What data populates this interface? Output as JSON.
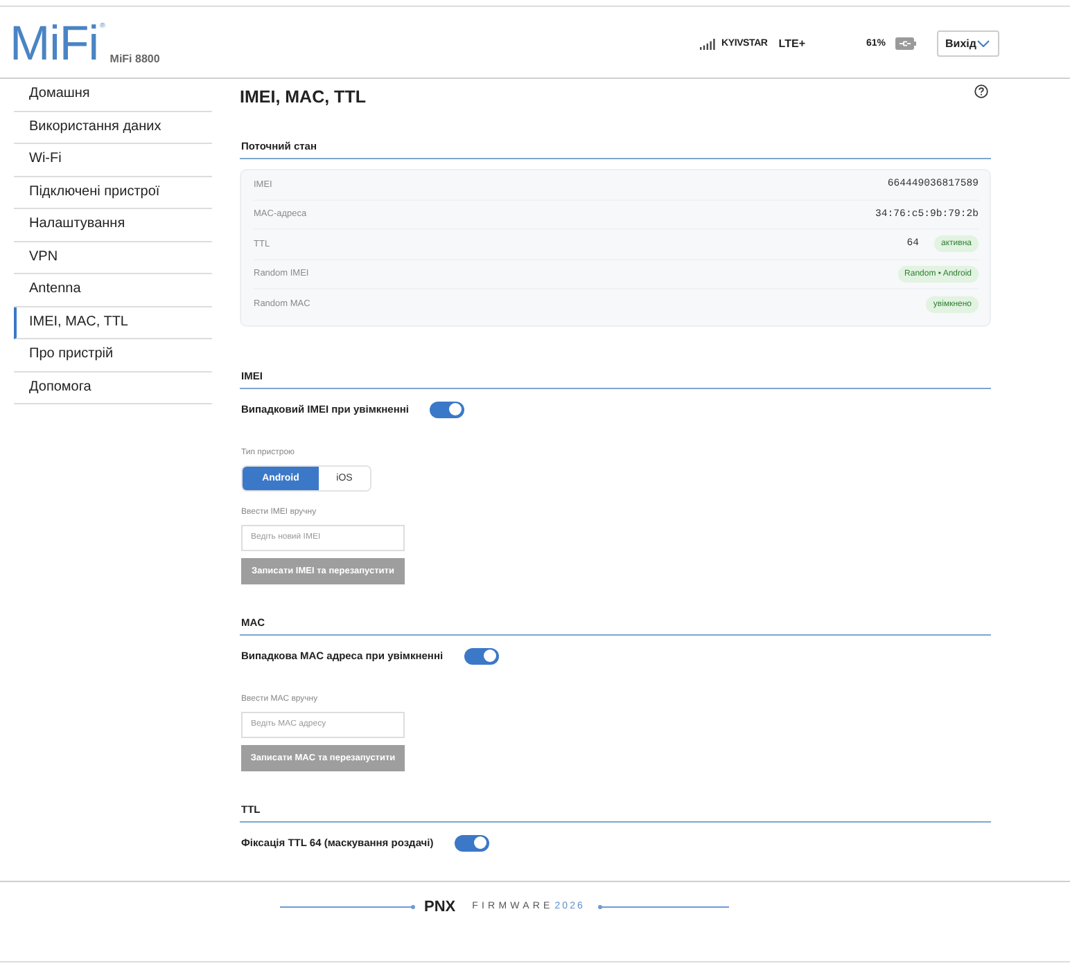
{
  "header": {
    "logo": "MiFi",
    "logo_mark": "®",
    "model": "MiFi 8800",
    "operator": "KYIVSTAR",
    "network": "LTE+",
    "battery": "61%",
    "logout_button": "Вихід"
  },
  "sidebar": {
    "items": [
      {
        "label": "Домашня",
        "selected": false
      },
      {
        "label": "Використання даних",
        "selected": false
      },
      {
        "label": "Wi-Fi",
        "selected": false
      },
      {
        "label": "Підключені пристрої",
        "selected": false
      },
      {
        "label": "Налаштування",
        "selected": false
      },
      {
        "label": "VPN",
        "selected": false
      },
      {
        "label": "Antenna",
        "selected": false
      },
      {
        "label": "IMEI, MAC, TTL",
        "selected": true
      },
      {
        "label": "Про пристрій",
        "selected": false
      },
      {
        "label": "Допомога",
        "selected": false
      }
    ]
  },
  "page": {
    "title": "IMEI, MAC, TTL"
  },
  "status": {
    "title": "Поточний стан",
    "rows": [
      {
        "label": "IMEI",
        "value": "664449036817589"
      },
      {
        "label": "MAC-адреса",
        "value": "34:76:c5:9b:79:2b"
      },
      {
        "label": "TTL",
        "value": "64",
        "badge": "активна"
      },
      {
        "label": "Random IMEI",
        "badge": "Random • Android"
      },
      {
        "label": "Random MAC",
        "badge": "увімкнено"
      }
    ]
  },
  "sections": [
    {
      "title": "IMEI",
      "toggle": {
        "label": "Випадковий IMEI при увімкненні",
        "on": true
      },
      "device_type": {
        "label": "Тип пристрою",
        "options": [
          {
            "label": "Android",
            "selected": true
          },
          {
            "label": "iOS",
            "selected": false
          }
        ]
      },
      "manual": {
        "label": "Ввести IMEI вручну",
        "placeholder": "Ведіть новий IMEI"
      },
      "button": {
        "label": "Записати IMEI та перезапустити",
        "disabled": true
      }
    },
    {
      "title": "MAC",
      "toggle": {
        "label": "Випадкова MAC адреса при увімкненні",
        "on": true
      },
      "manual": {
        "label": "Ввести MAC вручну",
        "placeholder": "Ведіть MAC адресу"
      },
      "button": {
        "label": "Записати MAC та перезапустити",
        "disabled": true
      }
    },
    {
      "title": "TTL",
      "toggle": {
        "label": "Фіксація TTL 64 (маскування роздачі)",
        "on": true
      }
    }
  ],
  "footer": {
    "brand": "PNX",
    "label": "FIRMWARE",
    "year": "2026"
  }
}
